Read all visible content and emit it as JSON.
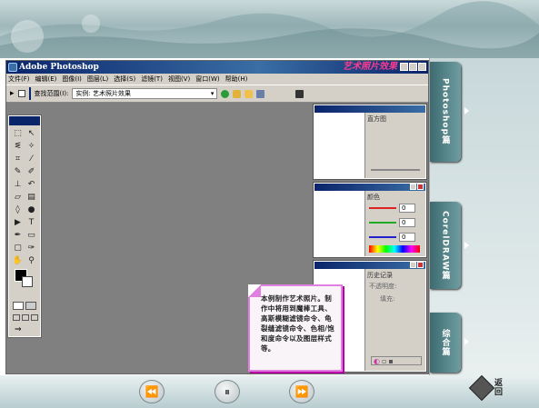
{
  "window": {
    "title": "Adobe Photoshop",
    "brand": "艺术照片效果",
    "menus": [
      "文件(F)",
      "编辑(E)",
      "图像(I)",
      "图层(L)",
      "选择(S)",
      "滤镜(T)",
      "视图(V)",
      "窗口(W)",
      "帮助(H)"
    ]
  },
  "options": {
    "find_label": "查找范围(I):",
    "folder": "实例: 艺术照片效果"
  },
  "panels": {
    "histogram_tab": "直方图",
    "color_tab": "颜色",
    "color_values": [
      "0",
      "0",
      "0"
    ],
    "history_tab": "历史记录",
    "history_label": "不透明度:",
    "fill_label": "填充:"
  },
  "note": {
    "text": "本例制作艺术照片。制作中将用到魔棒工具、高斯模糊滤镜命令、龟裂缝滤镜命令、色相/饱和度命令以及图层样式等。"
  },
  "right_tabs": [
    {
      "label": "Photoshop篇"
    },
    {
      "label": "CorelDRAW篇"
    },
    {
      "label": "综合篇"
    }
  ],
  "footer": {
    "prev_icon": "rewind-icon",
    "pause_icon": "pause-icon",
    "next_icon": "forward-icon",
    "back_label": "返回"
  },
  "colors": {
    "accent": "#e080e0",
    "tab": "#4d7c80",
    "titlebar": "#0a246a"
  }
}
